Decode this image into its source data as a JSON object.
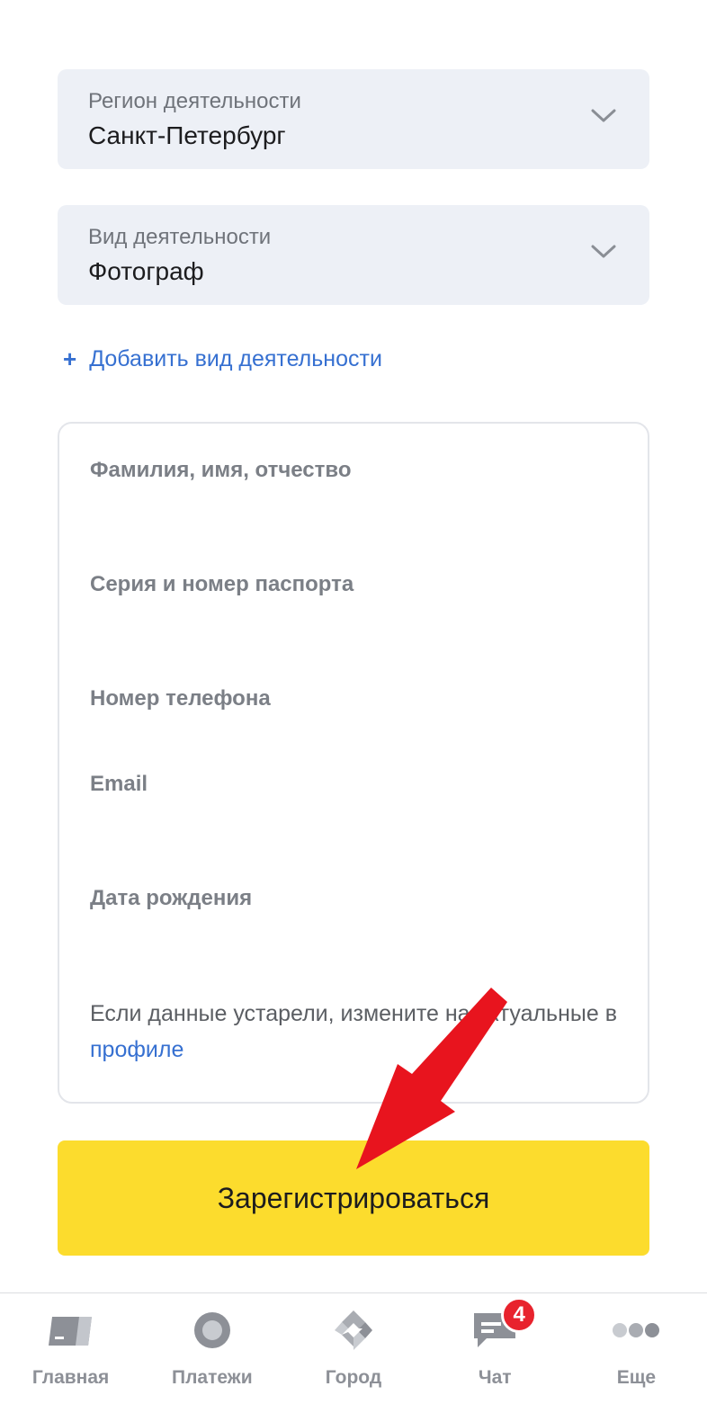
{
  "region": {
    "label": "Регион деятельности",
    "value": "Санкт-Петербург",
    "icon": "chevron-down-icon"
  },
  "activity": {
    "label": "Вид деятельности",
    "value": "Фотограф",
    "icon": "chevron-down-icon"
  },
  "add_activity": {
    "icon": "+",
    "label": "Добавить вид деятельности"
  },
  "personal_data": {
    "fields": [
      {
        "label": "Фамилия, имя, отчество"
      },
      {
        "label": "Серия и номер паспорта"
      },
      {
        "label": "Номер телефона"
      },
      {
        "label": "Email"
      },
      {
        "label": "Дата рождения"
      }
    ],
    "note_text": "Если данные устарели, измените на актуальные в ",
    "note_link": "профиле"
  },
  "register_button": "Зарегистрироваться",
  "tabbar": {
    "items": [
      {
        "label": "Главная",
        "icon": "home-card-icon"
      },
      {
        "label": "Платежи",
        "icon": "payments-circle-icon"
      },
      {
        "label": "Город",
        "icon": "city-diamond-icon"
      },
      {
        "label": "Чат",
        "icon": "chat-bubble-icon",
        "badge": "4"
      },
      {
        "label": "Еще",
        "icon": "more-dots-icon"
      }
    ]
  },
  "colors": {
    "accent_yellow": "#fcdc2d",
    "link_blue": "#3670d1",
    "badge_red": "#e8232d",
    "annotation_arrow": "#e8141e"
  }
}
